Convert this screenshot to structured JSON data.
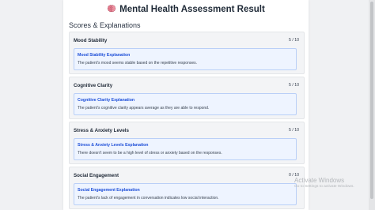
{
  "header": {
    "title": "Mental Health Assessment Result",
    "icon": "brain-icon"
  },
  "section": {
    "heading": "Scores & Explanations"
  },
  "categories": [
    {
      "name": "Mood Stability",
      "score": "5 / 10",
      "explanation_title": "Mood Stability Explanation",
      "explanation": "The patient's mood seems stable based on the repetitive responses."
    },
    {
      "name": "Cognitive Clarity",
      "score": "5 / 10",
      "explanation_title": "Cognitive Clarity Explanation",
      "explanation": "The patient's cognitive clarity appears average as they are able to respond."
    },
    {
      "name": "Stress & Anxiety Levels",
      "score": "5 / 10",
      "explanation_title": "Stress & Anxiety Levels Explanation",
      "explanation": "There doesn't seem to be a high level of stress or anxiety based on the responses."
    },
    {
      "name": "Social Engagement",
      "score": "0 / 10",
      "explanation_title": "Social Engagement Explanation",
      "explanation": "The patient's lack of engagement in conversation indicates low social interaction."
    }
  ],
  "watermark": {
    "title": "Activate Windows",
    "subtitle": "Go to Settings to activate Windows."
  },
  "colors": {
    "page_bg": "#f0f1f3",
    "card_bg": "#ffffff",
    "category_bg": "#f3f4f6",
    "explanation_bg": "#eef4ff",
    "explanation_border": "#b9cff7",
    "explanation_title": "#1d4ed8",
    "brain_icon": "#e57a8d"
  }
}
